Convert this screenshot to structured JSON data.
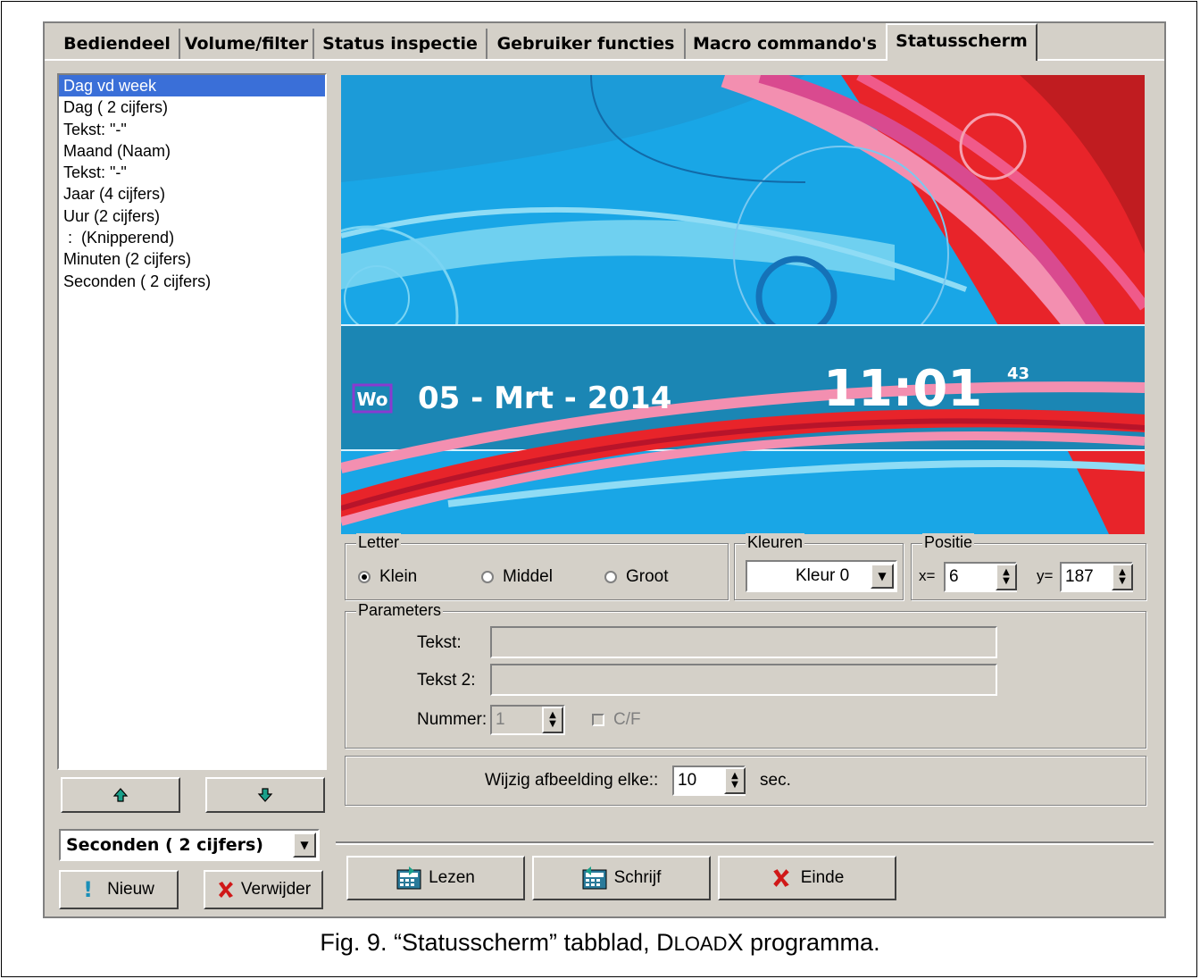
{
  "tabs": [
    "Bediendeel",
    "Volume/filter",
    "Status inspectie",
    "Gebruiker functies",
    "Macro commando's",
    "Statusscherm"
  ],
  "active_tab": "Statusscherm",
  "list": {
    "items": [
      "Dag vd week",
      "Dag ( 2 cijfers)",
      "Tekst: \"-\"",
      "Maand (Naam)",
      "Tekst: \"-\"",
      "Jaar (4 cijfers)",
      "Uur (2 cijfers)",
      " :  (Knipperend)",
      "Minuten (2 cijfers)",
      "Seconden ( 2 cijfers)"
    ],
    "selected_index": 0
  },
  "element_select": "Seconden ( 2 cijfers)",
  "buttons": {
    "nieuw": "Nieuw",
    "verwijder": "Verwijder",
    "lezen": "Lezen",
    "schrijf": "Schrijf",
    "einde": "Einde"
  },
  "preview": {
    "day": "Wo",
    "date": "05 - Mrt - 2014",
    "time": "11:01",
    "seconds": "43"
  },
  "letter": {
    "legend": "Letter",
    "options": [
      "Klein",
      "Middel",
      "Groot"
    ],
    "selected": "Klein"
  },
  "kleuren": {
    "legend": "Kleuren",
    "value": "Kleur 0"
  },
  "positie": {
    "legend": "Positie",
    "x_label": "x=",
    "x": "6",
    "y_label": "y=",
    "y": "187"
  },
  "parameters": {
    "legend": "Parameters",
    "tekst_label": "Tekst:",
    "tekst": "",
    "tekst2_label": "Tekst 2:",
    "tekst2": "",
    "nummer_label": "Nummer:",
    "nummer": "1",
    "cf_label": "C/F"
  },
  "wijzig": {
    "label": "Wijzig afbeelding elke::",
    "value": "10",
    "unit": "sec."
  },
  "caption": {
    "prefix": "Fig. 9. “Statusscherm” tabblad, ",
    "brand_d": "D",
    "brand_load": "LOAD",
    "brand_x": "X",
    "suffix": " programma."
  },
  "colors": {
    "selection": "#3a6fd8",
    "window": "#d4d0c8",
    "preview_blue": "#19a6e6",
    "preview_red": "#e8242a"
  }
}
